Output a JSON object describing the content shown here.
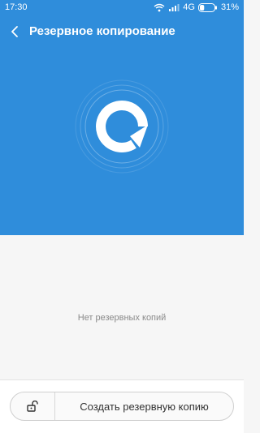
{
  "status_bar": {
    "time": "17:30",
    "network": "4G",
    "battery": "31%",
    "battery_level": 0.31
  },
  "header": {
    "title": "Резервное копирование",
    "back_icon": "chevron-left-icon"
  },
  "hero": {
    "icon": "backup-refresh-icon",
    "background_color": "#2f8ddb"
  },
  "content": {
    "empty_message": "Нет резервных копий"
  },
  "actions": {
    "create_backup_label": "Создать резервную копию",
    "lock_icon": "unlock-icon"
  }
}
